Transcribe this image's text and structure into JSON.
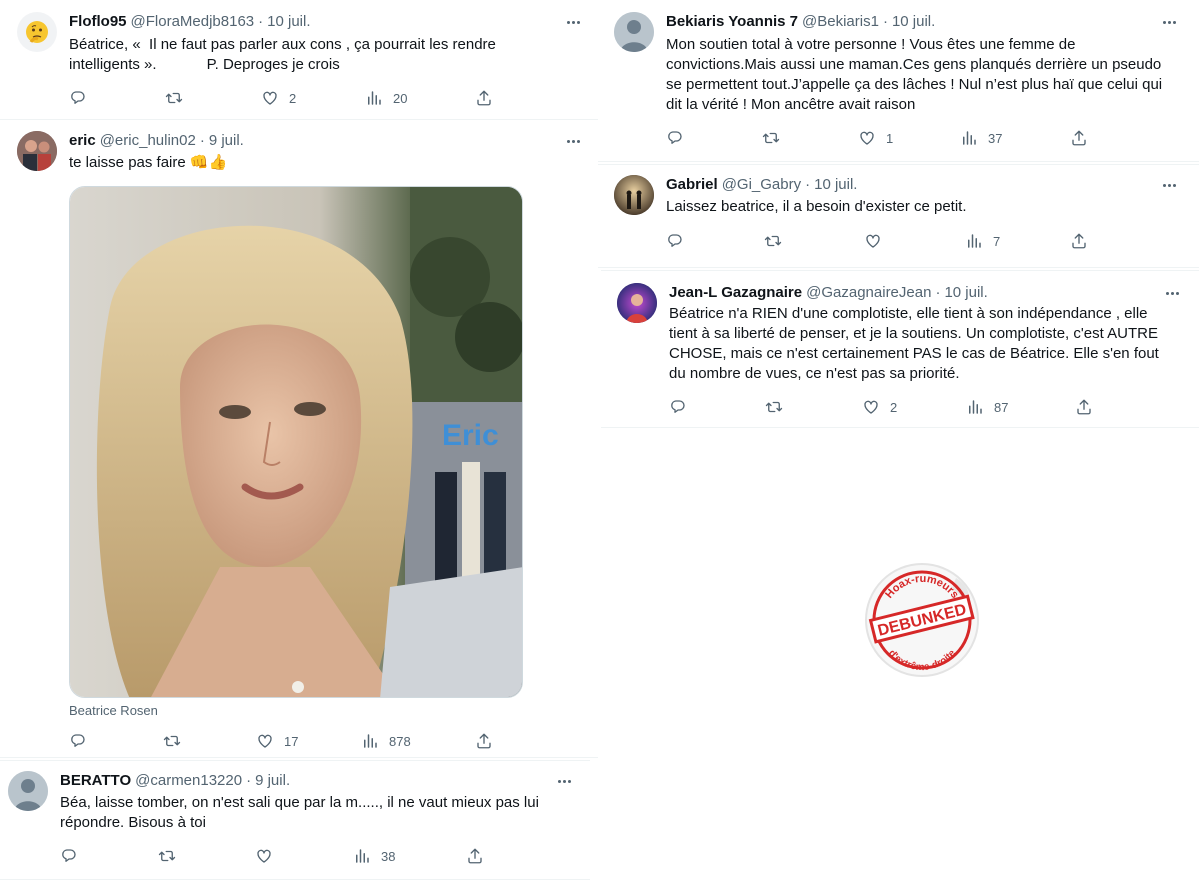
{
  "tweets": [
    {
      "name": "Floflo95",
      "handle": "@FloraMedjb8163",
      "sep": "·",
      "date": "10 juil.",
      "text_lines": [
        "Béatrice, «  Il ne faut pas parler aux cons , ça pourrait les rendre",
        "intelligents ».            P. Deproges je crois"
      ],
      "avatar": "thinking-face-emoji",
      "likes": "2",
      "views": "20"
    },
    {
      "name": "eric",
      "handle": "@eric_hulin02",
      "sep": "·",
      "date": "9 juil.",
      "text": "te laisse pas faire 👊👍",
      "avatar": "user-photo",
      "image_caption": "Beatrice Rosen",
      "image_overlay_text": "Eric",
      "likes": "17",
      "views": "878"
    },
    {
      "name": "BERATTO",
      "handle": "@carmen13220",
      "sep": "·",
      "date": "9 juil.",
      "text_lines": [
        "Béa, laisse tomber, on n'est sali que par la m....., il ne vaut mieux pas lui",
        "répondre. Bisous à toi"
      ],
      "avatar": "default-avatar",
      "likes": "",
      "views": "38"
    },
    {
      "name": "Bekiaris Yoannis 7",
      "handle": "@Bekiaris1",
      "sep": "·",
      "date": "10 juil.",
      "text_lines": [
        "Mon soutien total à votre personne ! Vous êtes une femme de",
        "convictions.Mais aussi une maman.Ces gens planqués derrière un pseudo",
        "se permettent tout.J’appelle ça des lâches ! Nul n’est plus haï que celui qui",
        "dit la vérité ! Mon ancêtre avait raison"
      ],
      "avatar": "default-avatar",
      "likes": "1",
      "views": "37"
    },
    {
      "name": "Gabriel",
      "handle": "@Gi_Gabry",
      "sep": "·",
      "date": "10 juil.",
      "text": "Laissez beatrice, il a besoin d'exister ce petit.",
      "avatar": "user-photo",
      "likes": "",
      "views": "7"
    },
    {
      "name": "Jean-L Gazagnaire",
      "handle": "@GazagnaireJean",
      "sep": "·",
      "date": "10 juil.",
      "text_lines": [
        "Béatrice n'a RIEN d'une complotiste, elle tient à son indépendance , elle",
        "tient à sa liberté de penser, et je la soutiens. Un complotiste, c'est AUTRE",
        "CHOSE, mais ce n'est certainement PAS le cas de Béatrice. Elle s'en fout",
        "du nombre de vues, ce n'est pas sa priorité."
      ],
      "avatar": "user-photo",
      "likes": "2",
      "views": "87"
    }
  ],
  "stamp": {
    "top_text": "Hoax-rumeurs",
    "center_text": "DEBUNKED",
    "bottom_text": "d'extrême-droite",
    "color": "#d62828"
  },
  "icons": [
    "reply-icon",
    "retweet-icon",
    "like-icon",
    "views-icon",
    "share-icon",
    "more-icon"
  ],
  "colors": {
    "text": "#0f1419",
    "secondary": "#536471",
    "border": "#eff3f4"
  }
}
